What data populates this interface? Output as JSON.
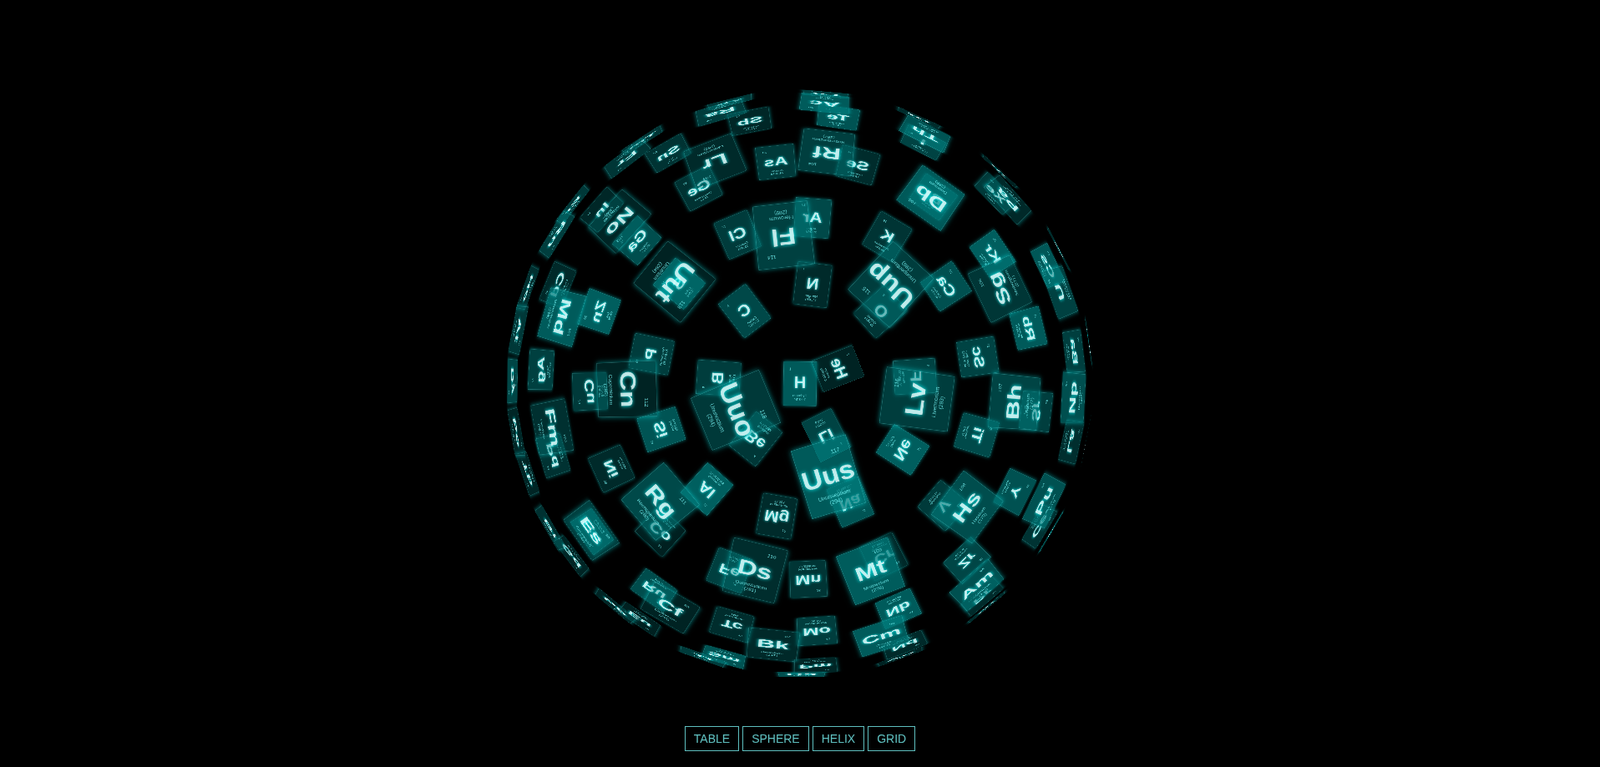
{
  "view": {
    "mode": "sphere"
  },
  "elements": [
    {
      "number": "1",
      "symbol": "H",
      "name": "Hydrogen",
      "mass": "1.00794"
    },
    {
      "number": "2",
      "symbol": "He",
      "name": "Helium",
      "mass": "4.002602"
    },
    {
      "number": "3",
      "symbol": "Li",
      "name": "Lithium",
      "mass": "6.941"
    },
    {
      "number": "4",
      "symbol": "Be",
      "name": "Beryllium",
      "mass": "9.012182"
    },
    {
      "number": "5",
      "symbol": "B",
      "name": "Boron",
      "mass": "10.811"
    },
    {
      "number": "6",
      "symbol": "C",
      "name": "Carbon",
      "mass": "12.0107"
    },
    {
      "number": "7",
      "symbol": "N",
      "name": "Nitrogen",
      "mass": "14.0067"
    },
    {
      "number": "8",
      "symbol": "O",
      "name": "Oxygen",
      "mass": "15.9994"
    },
    {
      "number": "9",
      "symbol": "F",
      "name": "Fluorine",
      "mass": "18.9984032"
    },
    {
      "number": "10",
      "symbol": "Ne",
      "name": "Neon",
      "mass": "20.1797"
    },
    {
      "number": "11",
      "symbol": "Na",
      "name": "Sodium",
      "mass": "22.98976..."
    },
    {
      "number": "12",
      "symbol": "Mg",
      "name": "Magnesium",
      "mass": "24.305"
    },
    {
      "number": "13",
      "symbol": "Al",
      "name": "Aluminium",
      "mass": "26.9815386"
    },
    {
      "number": "14",
      "symbol": "Si",
      "name": "Silicon",
      "mass": "28.0855"
    },
    {
      "number": "15",
      "symbol": "P",
      "name": "Phosphorus",
      "mass": "30.973762"
    },
    {
      "number": "16",
      "symbol": "S",
      "name": "Sulfur",
      "mass": "32.065"
    },
    {
      "number": "17",
      "symbol": "Cl",
      "name": "Chlorine",
      "mass": "35.453"
    },
    {
      "number": "18",
      "symbol": "Ar",
      "name": "Argon",
      "mass": "39.948"
    },
    {
      "number": "19",
      "symbol": "K",
      "name": "Potassium",
      "mass": "39.948"
    },
    {
      "number": "20",
      "symbol": "Ca",
      "name": "Calcium",
      "mass": "40.078"
    },
    {
      "number": "21",
      "symbol": "Sc",
      "name": "Scandium",
      "mass": "44.955912"
    },
    {
      "number": "22",
      "symbol": "Ti",
      "name": "Titanium",
      "mass": "47.867"
    },
    {
      "number": "23",
      "symbol": "V",
      "name": "Vanadium",
      "mass": "50.9415"
    },
    {
      "number": "24",
      "symbol": "Cr",
      "name": "Chromium",
      "mass": "51.9961"
    },
    {
      "number": "25",
      "symbol": "Mn",
      "name": "Manganese",
      "mass": "54.938045"
    },
    {
      "number": "26",
      "symbol": "Fe",
      "name": "Iron",
      "mass": "55.845"
    },
    {
      "number": "27",
      "symbol": "Co",
      "name": "Cobalt",
      "mass": "58.933195"
    },
    {
      "number": "28",
      "symbol": "Ni",
      "name": "Nickel",
      "mass": "58.6934"
    },
    {
      "number": "29",
      "symbol": "Cu",
      "name": "Copper",
      "mass": "63.546"
    },
    {
      "number": "30",
      "symbol": "Zn",
      "name": "Zinc",
      "mass": "65.38"
    },
    {
      "number": "31",
      "symbol": "Ga",
      "name": "Gallium",
      "mass": "69.723"
    },
    {
      "number": "32",
      "symbol": "Ge",
      "name": "Germanium",
      "mass": "72.63"
    },
    {
      "number": "33",
      "symbol": "As",
      "name": "Arsenic",
      "mass": "74.9216"
    },
    {
      "number": "34",
      "symbol": "Se",
      "name": "Selenium",
      "mass": "78.96"
    },
    {
      "number": "35",
      "symbol": "Br",
      "name": "Bromine",
      "mass": "79.904"
    },
    {
      "number": "36",
      "symbol": "Kr",
      "name": "Krypton",
      "mass": "83.798"
    },
    {
      "number": "37",
      "symbol": "Rb",
      "name": "Rubidium",
      "mass": "85.4678"
    },
    {
      "number": "38",
      "symbol": "Sr",
      "name": "Strontium",
      "mass": "87.62"
    },
    {
      "number": "39",
      "symbol": "Y",
      "name": "Yttrium",
      "mass": "88.90585"
    },
    {
      "number": "40",
      "symbol": "Zr",
      "name": "Zirconium",
      "mass": "91.224"
    },
    {
      "number": "41",
      "symbol": "Nb",
      "name": "Niobium",
      "mass": "92.90628"
    },
    {
      "number": "42",
      "symbol": "Mo",
      "name": "Molybdenum",
      "mass": "95.96"
    },
    {
      "number": "43",
      "symbol": "Tc",
      "name": "Technetium",
      "mass": "(98)"
    },
    {
      "number": "44",
      "symbol": "Ru",
      "name": "Ruthenium",
      "mass": "101.07"
    },
    {
      "number": "45",
      "symbol": "Rh",
      "name": "Rhodium",
      "mass": "102.9055"
    },
    {
      "number": "46",
      "symbol": "Pd",
      "name": "Palladium",
      "mass": "106.42"
    },
    {
      "number": "47",
      "symbol": "Ag",
      "name": "Silver",
      "mass": "107.8682"
    },
    {
      "number": "48",
      "symbol": "Cd",
      "name": "Cadmium",
      "mass": "112.411"
    },
    {
      "number": "49",
      "symbol": "In",
      "name": "Indium",
      "mass": "114.818"
    },
    {
      "number": "50",
      "symbol": "Sn",
      "name": "Tin",
      "mass": "118.71"
    },
    {
      "number": "51",
      "symbol": "Sb",
      "name": "Antimony",
      "mass": "121.76"
    },
    {
      "number": "52",
      "symbol": "Te",
      "name": "Tellurium",
      "mass": "127.6"
    },
    {
      "number": "53",
      "symbol": "I",
      "name": "Iodine",
      "mass": "126.90447"
    },
    {
      "number": "54",
      "symbol": "Xe",
      "name": "Xenon",
      "mass": "131.293"
    },
    {
      "number": "55",
      "symbol": "Cs",
      "name": "Caesium",
      "mass": "132.9054"
    },
    {
      "number": "56",
      "symbol": "Ba",
      "name": "Barium",
      "mass": "132.9054"
    },
    {
      "number": "57",
      "symbol": "La",
      "name": "Lanthanum",
      "mass": "138.90547"
    },
    {
      "number": "58",
      "symbol": "Ce",
      "name": "Cerium",
      "mass": "140.116"
    },
    {
      "number": "59",
      "symbol": "Pr",
      "name": "Praseodymium",
      "mass": "140.90765"
    },
    {
      "number": "60",
      "symbol": "Nd",
      "name": "Neodymium",
      "mass": "144.242"
    },
    {
      "number": "61",
      "symbol": "Pm",
      "name": "Promethium",
      "mass": "(145)"
    },
    {
      "number": "62",
      "symbol": "Sm",
      "name": "Samarium",
      "mass": "150.36"
    },
    {
      "number": "63",
      "symbol": "Eu",
      "name": "Europium",
      "mass": "151.964"
    },
    {
      "number": "64",
      "symbol": "Gd",
      "name": "Gadolinium",
      "mass": "157.25"
    },
    {
      "number": "65",
      "symbol": "Tb",
      "name": "Terbium",
      "mass": "158.92535"
    },
    {
      "number": "66",
      "symbol": "Dy",
      "name": "Dysprosium",
      "mass": "162.5"
    },
    {
      "number": "67",
      "symbol": "Ho",
      "name": "Holmium",
      "mass": "164.93032"
    },
    {
      "number": "68",
      "symbol": "Er",
      "name": "Erbium",
      "mass": "167.259"
    },
    {
      "number": "69",
      "symbol": "Tm",
      "name": "Thulium",
      "mass": "168.93421"
    },
    {
      "number": "70",
      "symbol": "Yb",
      "name": "Ytterbium",
      "mass": "173.054"
    },
    {
      "number": "71",
      "symbol": "Lu",
      "name": "Lutetium",
      "mass": "174.9668"
    },
    {
      "number": "72",
      "symbol": "Hf",
      "name": "Hafnium",
      "mass": "178.49"
    },
    {
      "number": "73",
      "symbol": "Ta",
      "name": "Tantalum",
      "mass": "180.94788"
    },
    {
      "number": "74",
      "symbol": "W",
      "name": "Tungsten",
      "mass": "183.84"
    },
    {
      "number": "75",
      "symbol": "Re",
      "name": "Rhenium",
      "mass": "186.207"
    },
    {
      "number": "76",
      "symbol": "Os",
      "name": "Osmium",
      "mass": "190.23"
    },
    {
      "number": "77",
      "symbol": "Ir",
      "name": "Iridium",
      "mass": "192.217"
    },
    {
      "number": "78",
      "symbol": "Pt",
      "name": "Platinum",
      "mass": "195.084"
    },
    {
      "number": "79",
      "symbol": "Au",
      "name": "Gold",
      "mass": "196.966569"
    },
    {
      "number": "80",
      "symbol": "Hg",
      "name": "Mercury",
      "mass": "200.59"
    },
    {
      "number": "81",
      "symbol": "Tl",
      "name": "Thallium",
      "mass": "204.3833"
    },
    {
      "number": "82",
      "symbol": "Pb",
      "name": "Lead",
      "mass": "207.2"
    },
    {
      "number": "83",
      "symbol": "Bi",
      "name": "Bismuth",
      "mass": "208.9804"
    },
    {
      "number": "84",
      "symbol": "Po",
      "name": "Polonium",
      "mass": "(209)"
    },
    {
      "number": "85",
      "symbol": "At",
      "name": "Astatine",
      "mass": "(210)"
    },
    {
      "number": "86",
      "symbol": "Rn",
      "name": "Radon",
      "mass": "(222)"
    },
    {
      "number": "87",
      "symbol": "Fr",
      "name": "Francium",
      "mass": "(223)"
    },
    {
      "number": "88",
      "symbol": "Ra",
      "name": "Radium",
      "mass": "(226)"
    },
    {
      "number": "89",
      "symbol": "Ac",
      "name": "Actinium",
      "mass": "(227)"
    },
    {
      "number": "90",
      "symbol": "Th",
      "name": "Thorium",
      "mass": "232.03806"
    },
    {
      "number": "91",
      "symbol": "Pa",
      "name": "Protactinium",
      "mass": "231.0588"
    },
    {
      "number": "92",
      "symbol": "U",
      "name": "Uranium",
      "mass": "238.02891"
    },
    {
      "number": "93",
      "symbol": "Np",
      "name": "Neptunium",
      "mass": "(237)"
    },
    {
      "number": "94",
      "symbol": "Pu",
      "name": "Plutonium",
      "mass": "(244)"
    },
    {
      "number": "95",
      "symbol": "Am",
      "name": "Americium",
      "mass": "(243)"
    },
    {
      "number": "96",
      "symbol": "Cm",
      "name": "Curium",
      "mass": "(247)"
    },
    {
      "number": "97",
      "symbol": "Bk",
      "name": "Berkelium",
      "mass": "(247)"
    },
    {
      "number": "98",
      "symbol": "Cf",
      "name": "Californium",
      "mass": "(251)"
    },
    {
      "number": "99",
      "symbol": "Es",
      "name": "Einstenium",
      "mass": "(252)"
    },
    {
      "number": "100",
      "symbol": "Fm",
      "name": "Fermium",
      "mass": "(257)"
    },
    {
      "number": "101",
      "symbol": "Md",
      "name": "Mendelevium",
      "mass": "(258)"
    },
    {
      "number": "102",
      "symbol": "No",
      "name": "Nobelium",
      "mass": "(259)"
    },
    {
      "number": "103",
      "symbol": "Lr",
      "name": "Lawrencium",
      "mass": "(262)"
    },
    {
      "number": "104",
      "symbol": "Rf",
      "name": "Rutherfordium",
      "mass": "(267)"
    },
    {
      "number": "105",
      "symbol": "Db",
      "name": "Dubnium",
      "mass": "(268)"
    },
    {
      "number": "106",
      "symbol": "Sg",
      "name": "Seaborgium",
      "mass": "(271)"
    },
    {
      "number": "107",
      "symbol": "Bh",
      "name": "Bohrium",
      "mass": "(272)"
    },
    {
      "number": "108",
      "symbol": "Hs",
      "name": "Hassium",
      "mass": "(270)"
    },
    {
      "number": "109",
      "symbol": "Mt",
      "name": "Meitnerium",
      "mass": "(276)"
    },
    {
      "number": "110",
      "symbol": "Ds",
      "name": "Darmstadium",
      "mass": "(281)"
    },
    {
      "number": "111",
      "symbol": "Rg",
      "name": "Roentgenium",
      "mass": "(280)"
    },
    {
      "number": "112",
      "symbol": "Cn",
      "name": "Copernicium",
      "mass": "(285)"
    },
    {
      "number": "113",
      "symbol": "Uut",
      "name": "Unutrium",
      "mass": "(284)"
    },
    {
      "number": "114",
      "symbol": "Fl",
      "name": "Flerovium",
      "mass": "(289)"
    },
    {
      "number": "115",
      "symbol": "Uup",
      "name": "Ununpentium",
      "mass": "(288)"
    },
    {
      "number": "116",
      "symbol": "Lv",
      "name": "Livermorium",
      "mass": "(293)"
    },
    {
      "number": "117",
      "symbol": "Uus",
      "name": "Ununseptium",
      "mass": "(294)"
    },
    {
      "number": "118",
      "symbol": "Uuo",
      "name": "Ununoctium",
      "mass": "(294)"
    }
  ],
  "menu": [
    {
      "label": "TABLE"
    },
    {
      "label": "SPHERE"
    },
    {
      "label": "HELIX"
    },
    {
      "label": "GRID"
    }
  ]
}
